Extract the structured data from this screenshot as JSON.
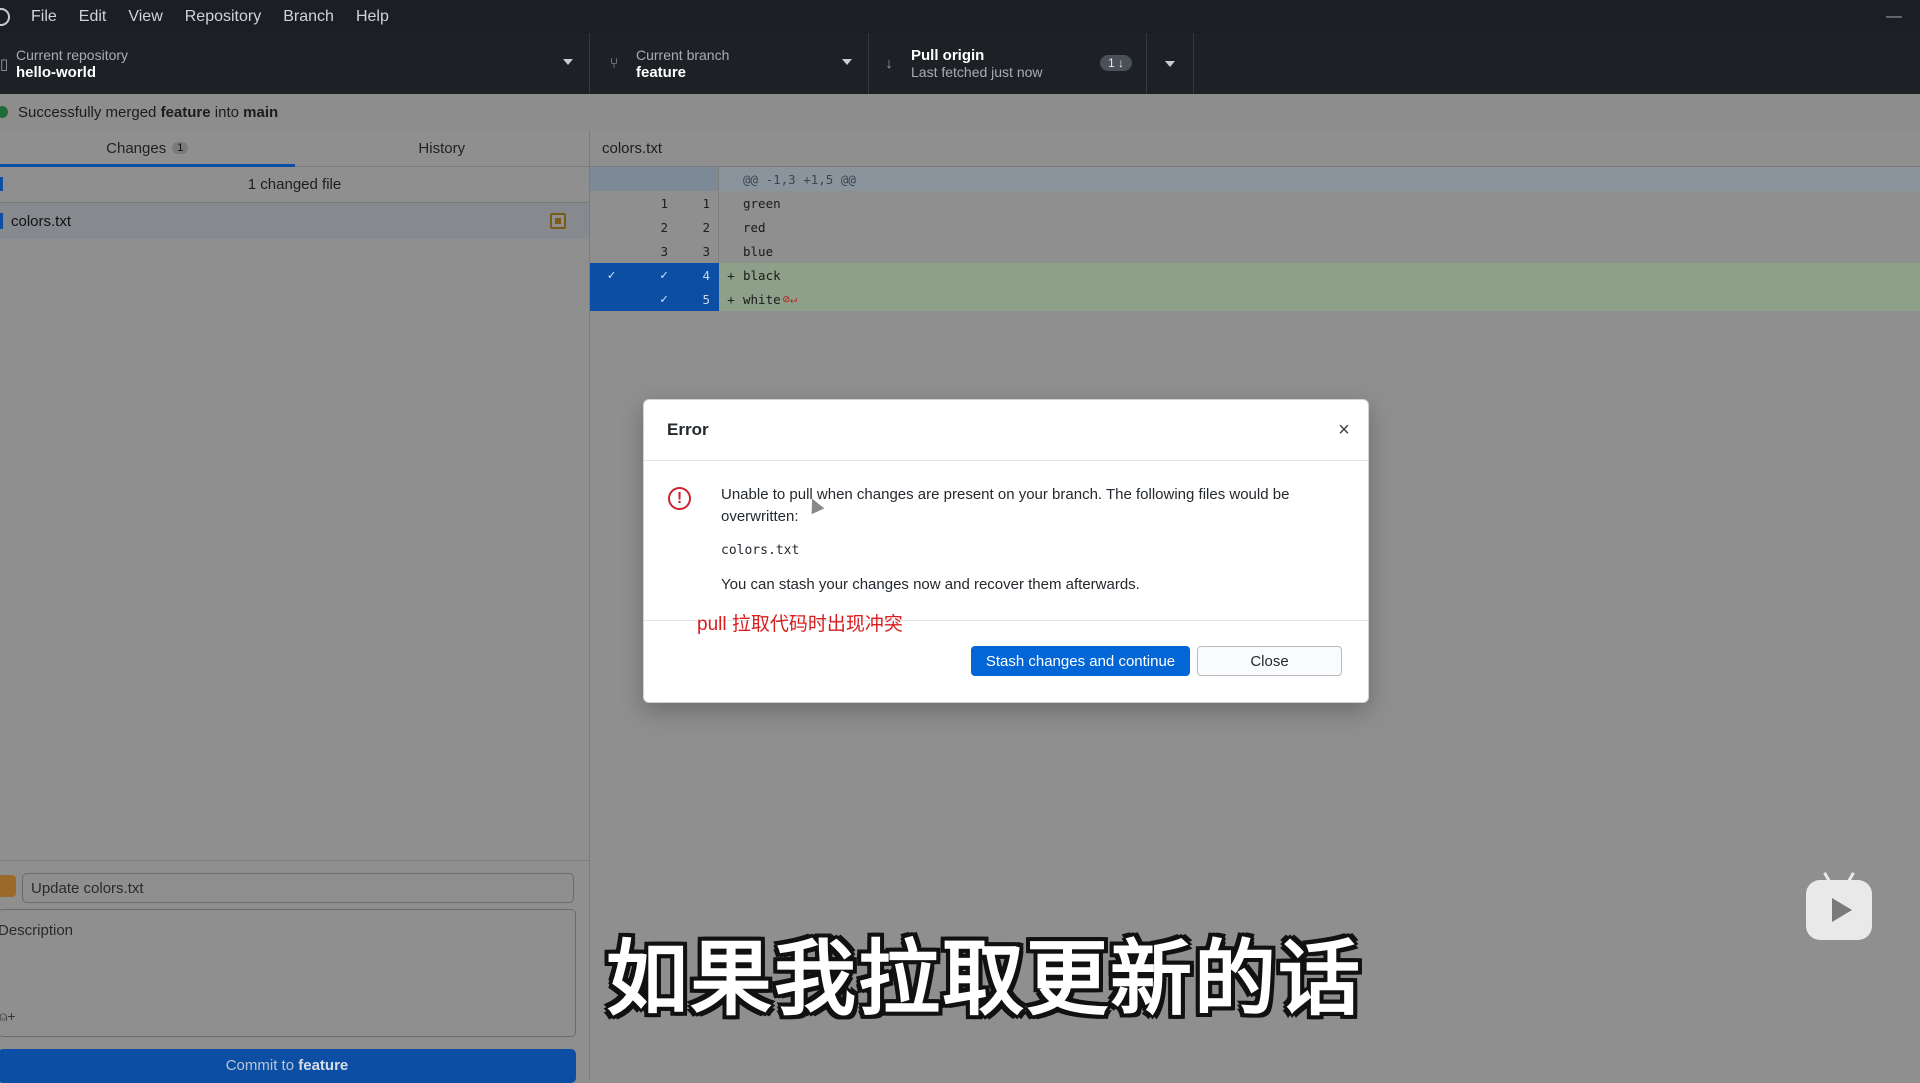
{
  "menubar": {
    "items": [
      "File",
      "Edit",
      "View",
      "Repository",
      "Branch",
      "Help"
    ],
    "minimize": "—"
  },
  "toolbar": {
    "repo": {
      "label": "Current repository",
      "value": "hello-world"
    },
    "branch": {
      "label": "Current branch",
      "value": "feature"
    },
    "pull": {
      "label": "Pull origin",
      "sub": "Last fetched just now",
      "badge": "1 ↓"
    }
  },
  "banner": {
    "prefix": "Successfully merged",
    "source": "feature",
    "middle": "into",
    "target": "main"
  },
  "sidebar": {
    "tabs": [
      {
        "label": "Changes",
        "count": "1"
      },
      {
        "label": "History"
      }
    ],
    "changed_header": "1 changed file",
    "files": [
      {
        "name": "colors.txt"
      }
    ],
    "commit": {
      "summary_placeholder": "Update colors.txt",
      "description_placeholder": "Description",
      "button_prefix": "Commit to",
      "button_branch": "feature"
    }
  },
  "diff": {
    "filename": "colors.txt",
    "hunk": "@@ -1,3 +1,5 @@",
    "lines": [
      {
        "old": "1",
        "new": "1",
        "mark": "",
        "text": "green"
      },
      {
        "old": "2",
        "new": "2",
        "mark": "",
        "text": "red"
      },
      {
        "old": "3",
        "new": "3",
        "mark": "",
        "text": "blue"
      },
      {
        "old": "",
        "new": "4",
        "mark": "+",
        "text": "black"
      },
      {
        "old": "",
        "new": "5",
        "mark": "+",
        "text": "white"
      }
    ]
  },
  "dialog": {
    "title": "Error",
    "message": "Unable to pull when changes are present on your branch. The following files would be overwritten:",
    "file": "colors.txt",
    "stash_note": "You can stash your changes now and recover them afterwards.",
    "annotation": "pull 拉取代码时出现冲突",
    "primary_label": "Stash changes and continue",
    "secondary_label": "Close",
    "close_icon": "×"
  },
  "overlay": {
    "subtitle": "如果我拉取更新的话"
  },
  "colors": {
    "accent": "#0366d6",
    "selection": "#0c4ea3",
    "error": "#cb2431",
    "annotation": "#d81e1e"
  }
}
